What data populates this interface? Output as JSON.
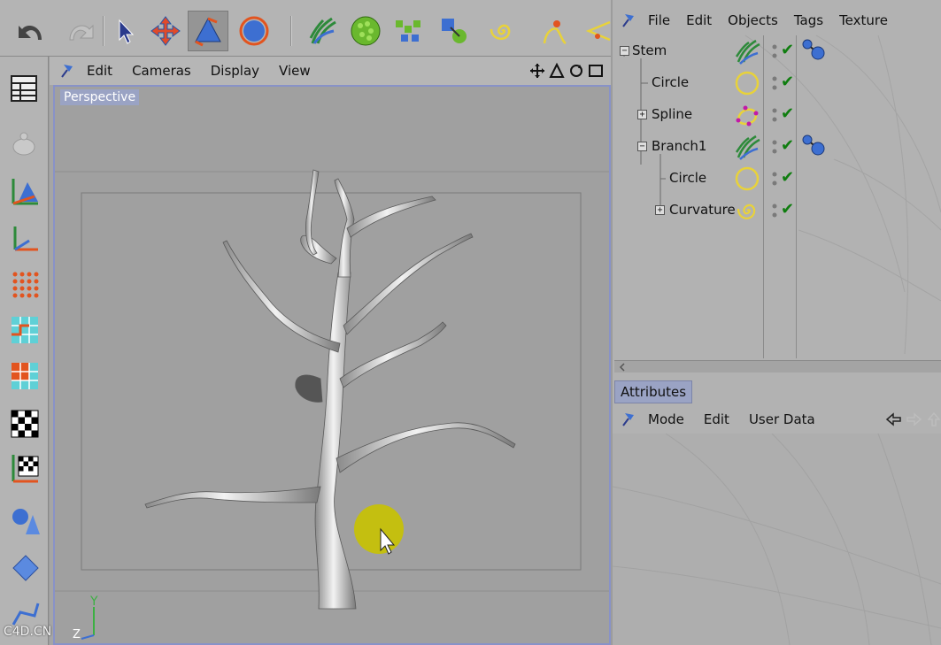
{
  "viewport": {
    "menu": [
      "Edit",
      "Cameras",
      "Display",
      "View"
    ],
    "camera_label": "Perspective"
  },
  "object_manager": {
    "menu": [
      "File",
      "Edit",
      "Objects",
      "Tags",
      "Texture"
    ],
    "tree": [
      {
        "label": "Stem",
        "icon": "hair-icon",
        "expander": "−",
        "tag": "render-tag-icon"
      },
      {
        "label": "Circle",
        "icon": "circle-spline-icon",
        "expander": "",
        "tag": ""
      },
      {
        "label": "Spline",
        "icon": "spline-icon",
        "expander": "+",
        "tag": ""
      },
      {
        "label": "Branch1",
        "icon": "hair-icon",
        "expander": "−",
        "tag": "render-tag-icon"
      },
      {
        "label": "Circle",
        "icon": "circle-spline-icon",
        "expander": "",
        "tag": ""
      },
      {
        "label": "Curvature",
        "icon": "spiral-spline-icon",
        "expander": "+",
        "tag": ""
      }
    ]
  },
  "attributes": {
    "tab_label": "Attributes",
    "menu": [
      "Mode",
      "Edit",
      "User Data"
    ]
  },
  "axis": {
    "y_label": "Y",
    "z_label": "Z"
  },
  "watermark": "C4D.CN",
  "colors": {
    "accent": "#8892c8",
    "check": "#0f7d0f",
    "spline_yellow": "#e8d23a"
  }
}
